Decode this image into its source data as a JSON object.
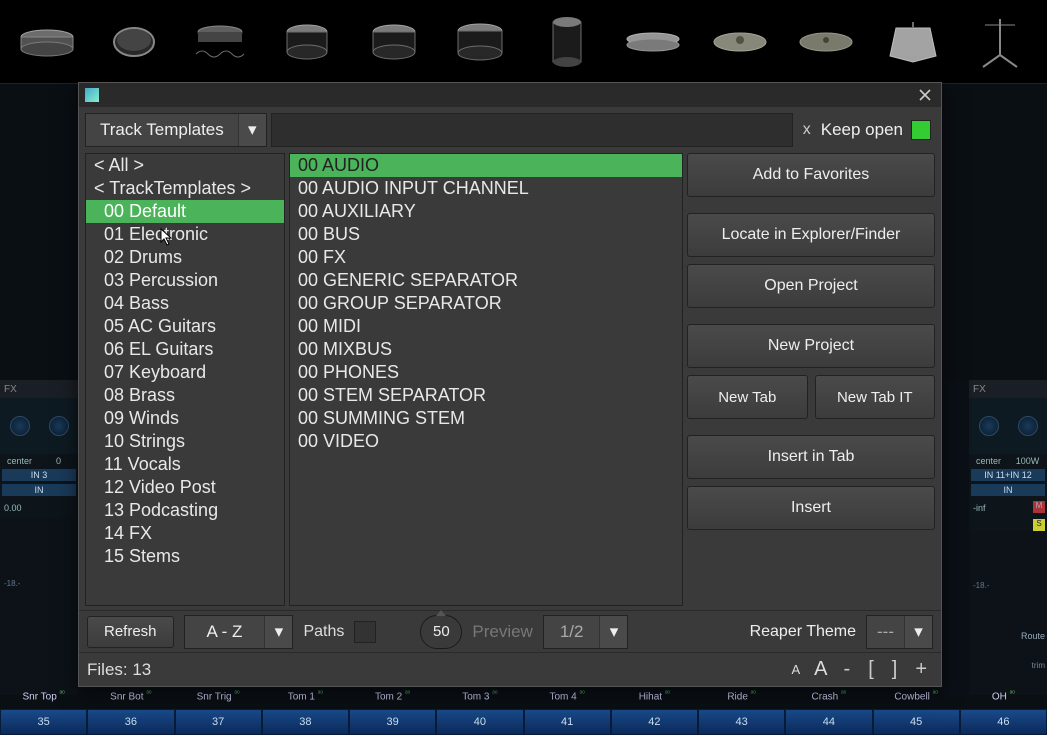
{
  "drum_icons": [
    "snare",
    "tambourine",
    "snare-wave",
    "tom1",
    "tom2",
    "floor-tom",
    "kick",
    "hihat",
    "crash",
    "ride",
    "cowbell",
    "stand"
  ],
  "dialog": {
    "type_dropdown": "Track Templates",
    "search_value": "",
    "clear_label": "x",
    "keep_open_label": "Keep open",
    "categories_header_all": "< All >",
    "categories_header_tt": "< TrackTemplates >",
    "categories": [
      "00 Default",
      "01 Electronic",
      "02 Drums",
      "03 Percussion",
      "04 Bass",
      "05 AC Guitars",
      "06 EL Guitars",
      "07 Keyboard",
      "08 Brass",
      "09 Winds",
      "10 Strings",
      "11 Vocals",
      "12 Video Post",
      "13 Podcasting",
      "14 FX",
      "15 Stems"
    ],
    "selected_category_index": 0,
    "items": [
      "00 AUDIO",
      "00 AUDIO INPUT CHANNEL",
      "00 AUXILIARY",
      "00 BUS",
      "00 FX",
      "00 GENERIC SEPARATOR",
      "00 GROUP SEPARATOR",
      "00 MIDI",
      "00 MIXBUS",
      "00 PHONES",
      "00 STEM SEPARATOR",
      "00 SUMMING STEM",
      "00 VIDEO"
    ],
    "selected_item_index": 0,
    "buttons": {
      "favorites": "Add to Favorites",
      "locate": "Locate in Explorer/Finder",
      "open": "Open Project",
      "newproj": "New Project",
      "newtab": "New Tab",
      "newtabit": "New Tab IT",
      "insertintab": "Insert in Tab",
      "insert": "Insert"
    },
    "bottom": {
      "refresh": "Refresh",
      "sort": "A - Z",
      "paths_label": "Paths",
      "columns": "50",
      "preview": "Preview",
      "page": "1/2",
      "theme_label": "Reaper Theme",
      "theme_value": "---",
      "files_label": "Files: 13",
      "font_small": "A",
      "font_large": "A",
      "minus": "-",
      "bracket_l": "[",
      "bracket_r": "]",
      "plus": "+"
    }
  },
  "mixer_left": {
    "fx": "FX",
    "center": "center",
    "gain": "0",
    "in": "IN 3",
    "in_btn": "IN",
    "db": "0.00",
    "tick": "-18.-"
  },
  "mixer_right": {
    "fx": "FX",
    "center": "center",
    "gain": "100W",
    "in": "IN 11+IN 12",
    "in_btn": "IN",
    "db": "-inf",
    "m": "M",
    "s": "S",
    "tick": "-18.-",
    "trim": "trim",
    "route": "Route"
  },
  "track_labels": [
    "Snr Top",
    "Snr Bot",
    "Snr Trig",
    "Tom 1",
    "Tom 2",
    "Tom 3",
    "Tom 4",
    "Hihat",
    "Ride",
    "Crash",
    "Cowbell",
    "OH"
  ],
  "track_numbers": [
    "35",
    "36",
    "37",
    "38",
    "39",
    "40",
    "41",
    "42",
    "43",
    "44",
    "45",
    "46"
  ]
}
